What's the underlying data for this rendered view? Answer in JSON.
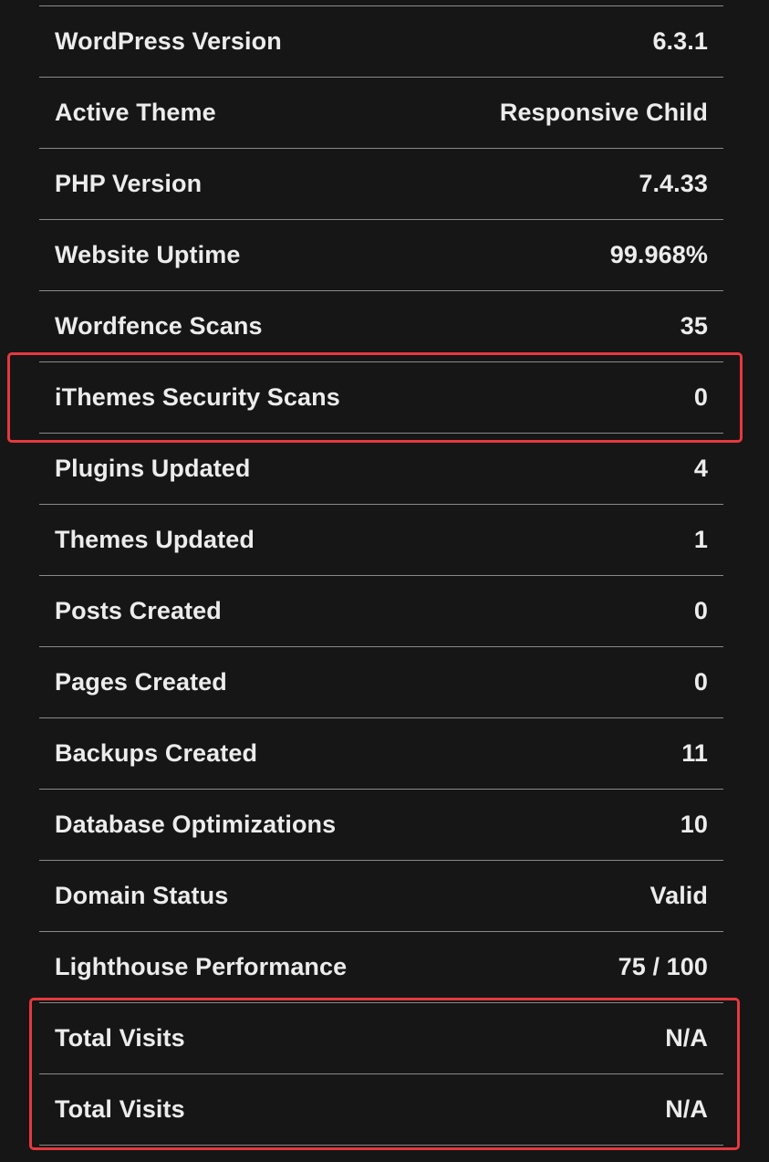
{
  "stats": [
    {
      "label": "WordPress Version",
      "value": "6.3.1"
    },
    {
      "label": "Active Theme",
      "value": "Responsive Child"
    },
    {
      "label": "PHP Version",
      "value": "7.4.33"
    },
    {
      "label": "Website Uptime",
      "value": "99.968%"
    },
    {
      "label": "Wordfence Scans",
      "value": "35"
    },
    {
      "label": "iThemes Security Scans",
      "value": "0"
    },
    {
      "label": "Plugins Updated",
      "value": "4"
    },
    {
      "label": "Themes Updated",
      "value": "1"
    },
    {
      "label": "Posts Created",
      "value": "0"
    },
    {
      "label": "Pages Created",
      "value": "0"
    },
    {
      "label": "Backups Created",
      "value": "11"
    },
    {
      "label": "Database Optimizations",
      "value": "10"
    },
    {
      "label": "Domain Status",
      "value": "Valid"
    },
    {
      "label": "Lighthouse Performance",
      "value": "75 / 100"
    },
    {
      "label": "Total Visits",
      "value": "N/A"
    },
    {
      "label": "Total Visits",
      "value": "N/A"
    }
  ],
  "colors": {
    "background": "#161616",
    "text": "#ececec",
    "divider": "#8a8a8a",
    "highlight": "#e5393f"
  }
}
